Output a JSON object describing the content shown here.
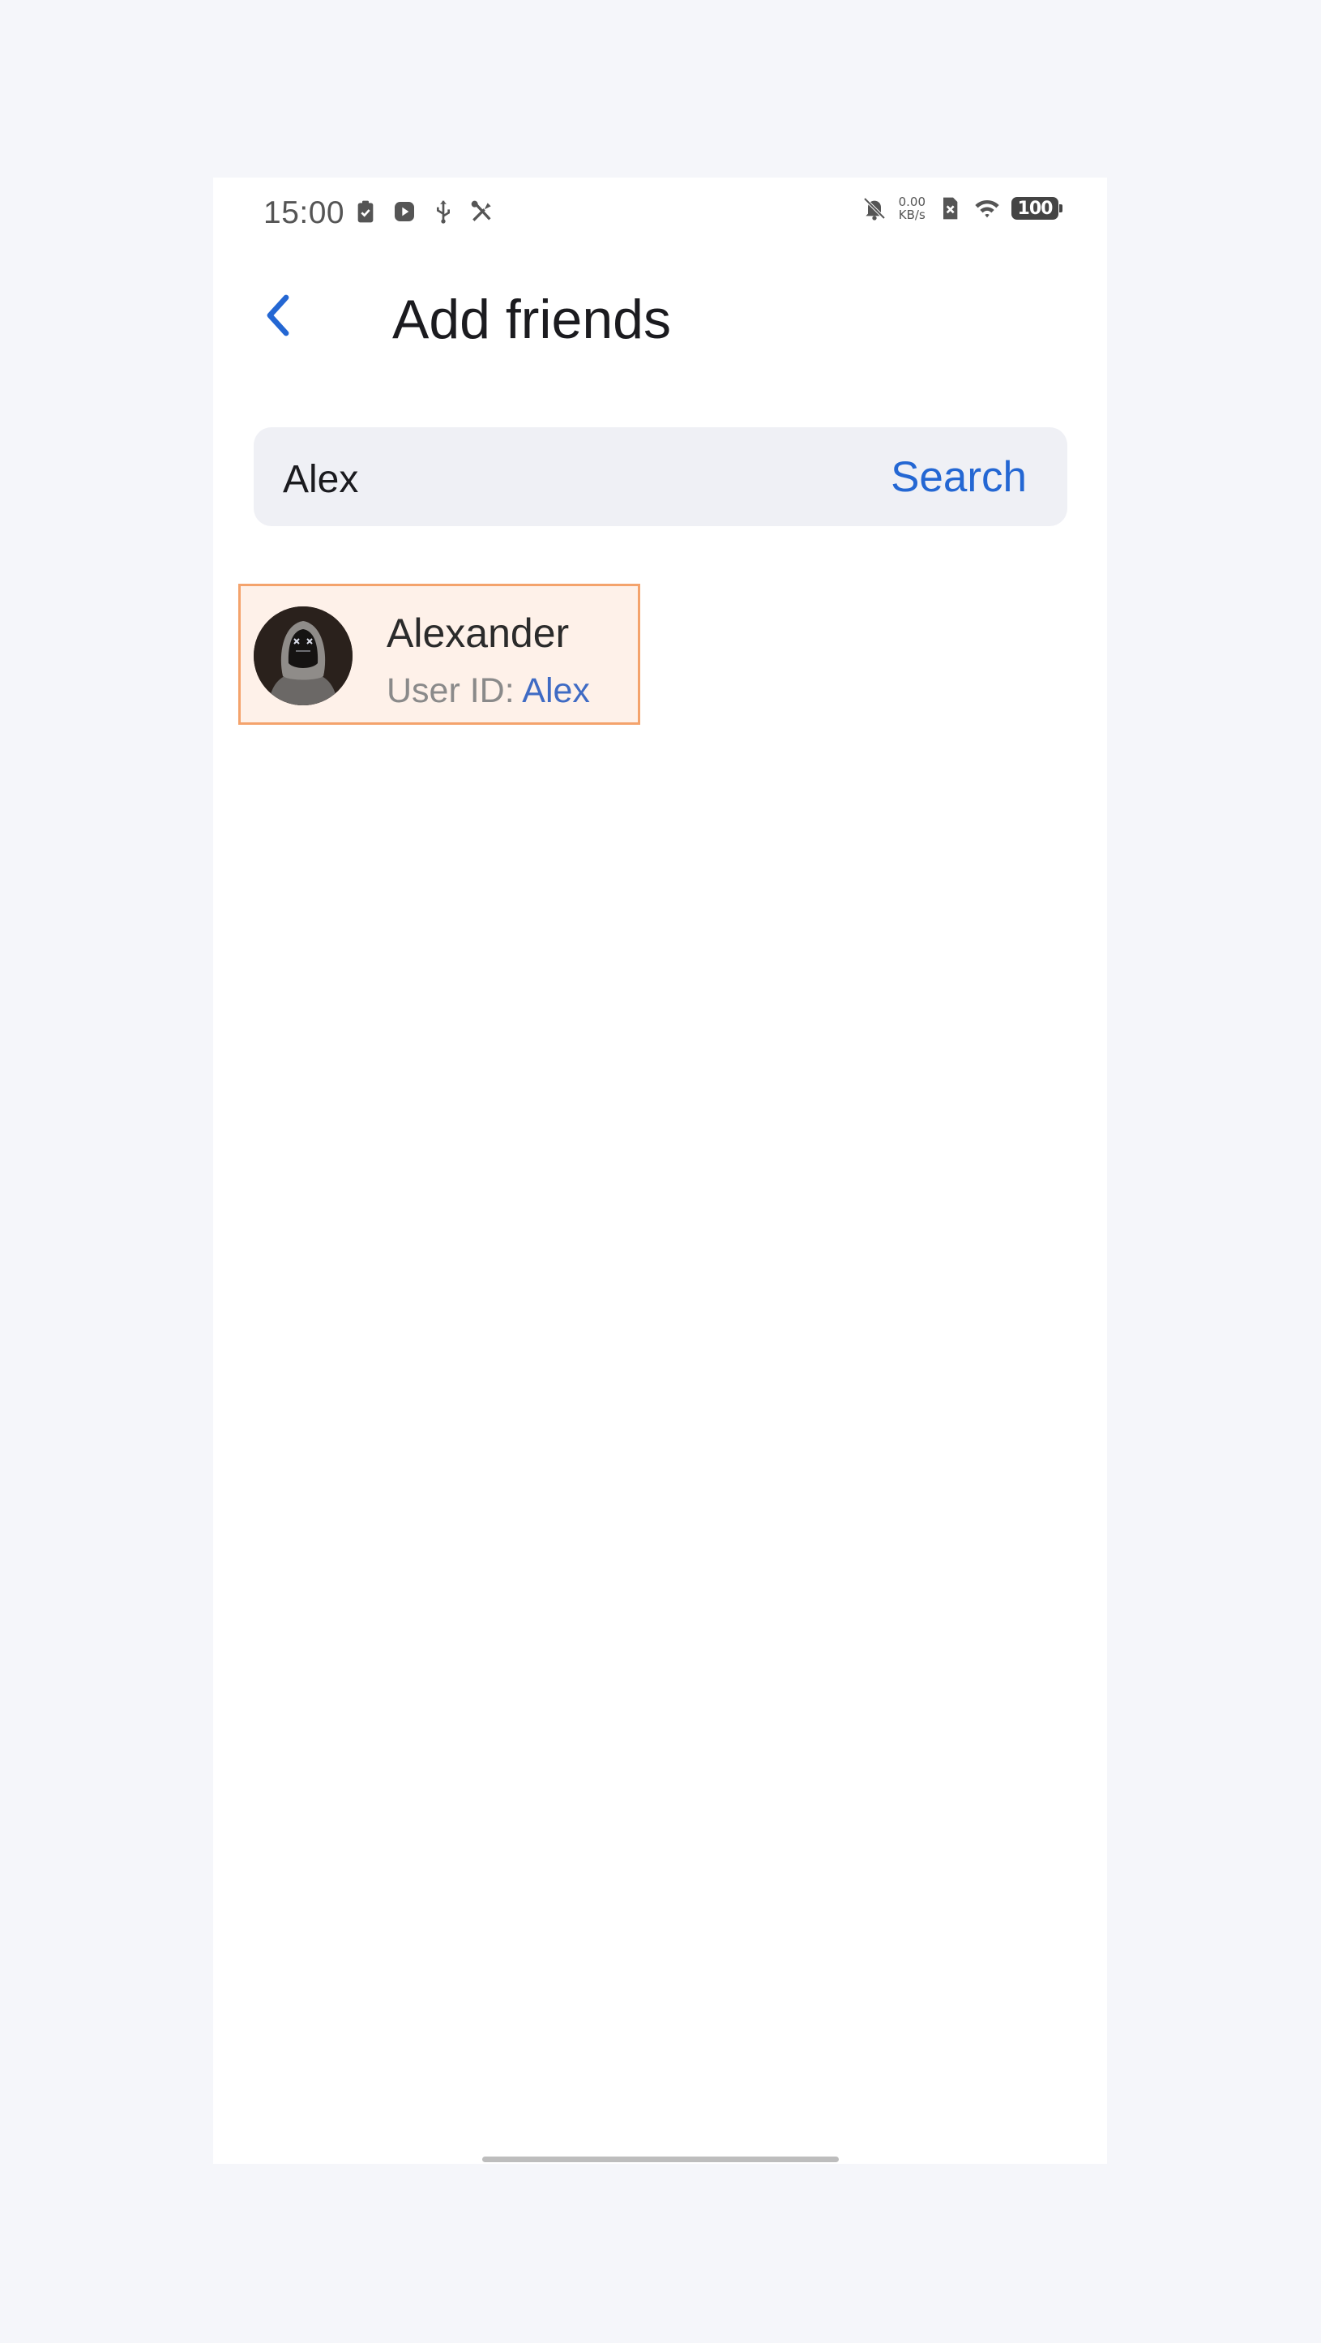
{
  "status_bar": {
    "time": "15:00",
    "speed_value": "0.00",
    "speed_unit": "KB/s",
    "battery": "100",
    "left_icons": [
      "clipboard-check-icon",
      "play-box-icon",
      "usb-icon",
      "tools-icon"
    ],
    "right_icons": [
      "bell-off-icon",
      "sim-off-icon",
      "wifi-icon",
      "battery-icon"
    ]
  },
  "header": {
    "title": "Add friends",
    "back_icon": "chevron-left-icon"
  },
  "search": {
    "value": "Alex",
    "button_label": "Search"
  },
  "results": [
    {
      "name": "Alexander",
      "uid_label": "User ID: ",
      "uid_value": "Alex",
      "avatar_icon": "hooded-figure-avatar"
    }
  ],
  "colors": {
    "accent": "#2467d3",
    "highlight_bg": "#fef1e9",
    "highlight_border": "#f4a36c"
  }
}
